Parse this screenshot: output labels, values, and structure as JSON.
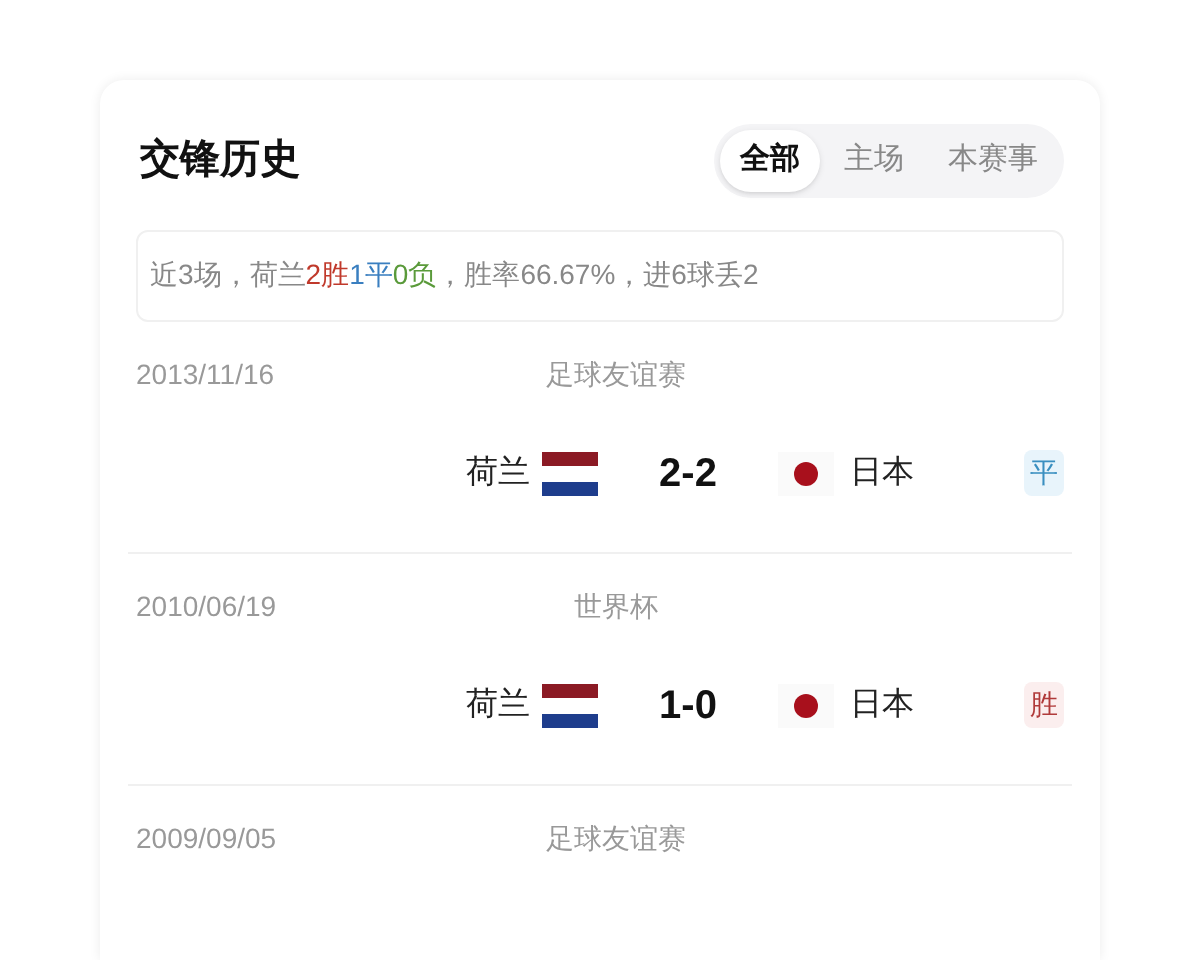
{
  "header": {
    "title": "交锋历史"
  },
  "tabs": [
    {
      "label": "全部",
      "selected": true
    },
    {
      "label": "主场",
      "selected": false
    },
    {
      "label": "本赛事",
      "selected": false
    }
  ],
  "summary": [
    {
      "text": "近3场，荷兰",
      "kind": "plain"
    },
    {
      "text": "2胜",
      "kind": "win"
    },
    {
      "text": "1平",
      "kind": "draw"
    },
    {
      "text": "0负",
      "kind": "loss"
    },
    {
      "text": "，胜率66.67%，进6球丢2",
      "kind": "plain"
    }
  ],
  "matches": [
    {
      "date": "2013/11/16",
      "competition": "足球友谊赛",
      "home": {
        "name": "荷兰",
        "kind": "tricolor"
      },
      "score": "2-2",
      "away": {
        "name": "日本",
        "kind": "disc"
      },
      "result": {
        "text": "平",
        "kind": "draw"
      }
    },
    {
      "date": "2010/06/19",
      "competition": "世界杯",
      "home": {
        "name": "荷兰",
        "kind": "tricolor"
      },
      "score": "1-0",
      "away": {
        "name": "日本",
        "kind": "disc"
      },
      "result": {
        "text": "胜",
        "kind": "win"
      }
    },
    {
      "date": "2009/09/05",
      "competition": "足球友谊赛"
    }
  ]
}
